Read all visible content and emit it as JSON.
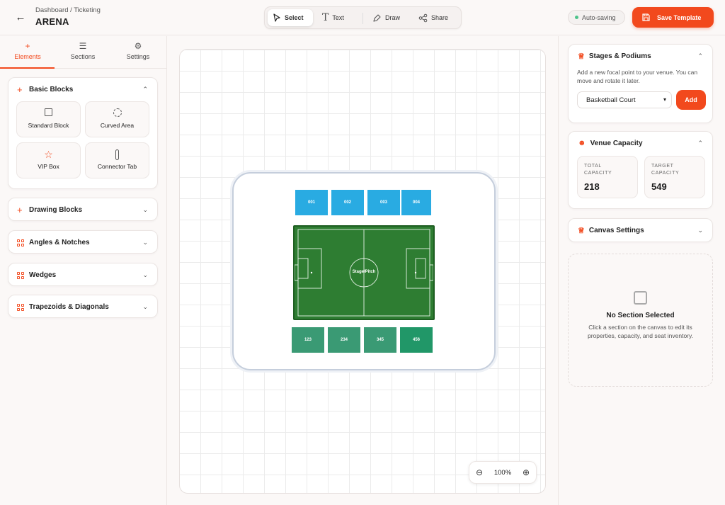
{
  "header": {
    "breadcrumb": "Dashboard / Ticketing",
    "title": "ARENA",
    "autosave_label": "Auto-saving",
    "save_label": "Save Template"
  },
  "toolbar": {
    "select": "Select",
    "text": "Text",
    "draw": "Draw",
    "share": "Share"
  },
  "left_tabs": {
    "elements": "Elements",
    "sections": "Sections",
    "settings": "Settings"
  },
  "basic_blocks": {
    "title": "Basic Blocks",
    "items": [
      "Standard Block",
      "Curved Area",
      "VIP Box",
      "Connector Tab"
    ]
  },
  "groups": [
    "Drawing Blocks",
    "Angles & Notches",
    "Wedges",
    "Trapezoids & Diagonals"
  ],
  "canvas": {
    "top_sections": [
      "001",
      "002",
      "003",
      "004"
    ],
    "bottom_sections": [
      "123",
      "234",
      "345",
      "456"
    ],
    "pitch_label": "Stage/Pitch",
    "zoom": "100%",
    "colors": {
      "top_section": "#29abe2",
      "bottom_section": "#3a9a74",
      "bottom_section_last": "#219768",
      "pitch": "#2e7d32"
    }
  },
  "stages": {
    "title": "Stages & Podiums",
    "description": "Add a new focal point to your venue. You can move and rotate it later.",
    "selected": "Basketball Court",
    "add_label": "Add"
  },
  "capacity": {
    "title": "Venue Capacity",
    "total_label": "TOTAL CAPACITY",
    "total_value": "218",
    "target_label": "TARGET CAPACITY",
    "target_value": "549"
  },
  "canvas_settings": {
    "title": "Canvas Settings"
  },
  "empty_state": {
    "title": "No Section Selected",
    "text": "Click a section on the canvas to edit its properties, capacity, and seat inventory."
  },
  "accent": "#f2491d"
}
